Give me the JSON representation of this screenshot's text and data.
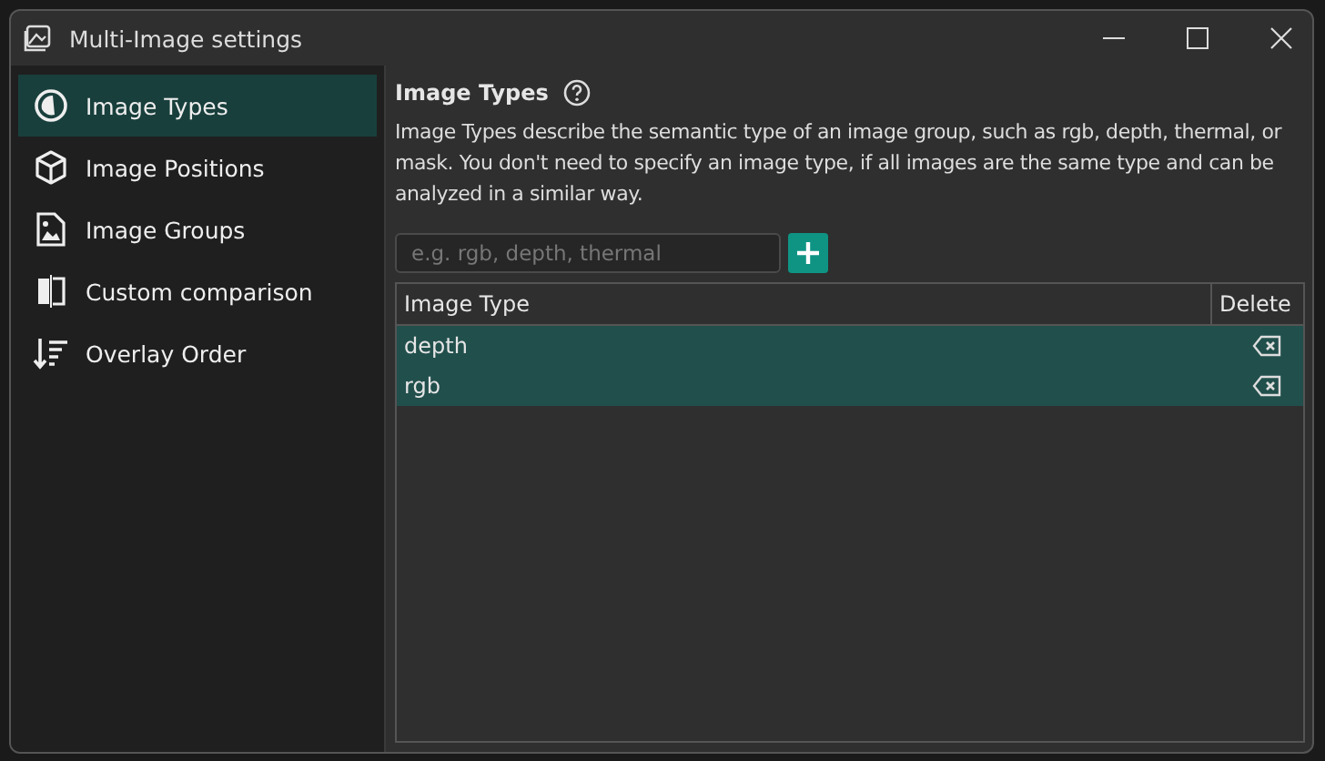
{
  "window": {
    "title": "Multi-Image settings"
  },
  "sidebar": {
    "items": [
      {
        "label": "Image Types",
        "selected": true
      },
      {
        "label": "Image Positions",
        "selected": false
      },
      {
        "label": "Image Groups",
        "selected": false
      },
      {
        "label": "Custom comparison",
        "selected": false
      },
      {
        "label": "Overlay Order",
        "selected": false
      }
    ]
  },
  "section": {
    "title": "Image Types",
    "description": "Image Types describe the semantic type of an image group, such as rgb, depth, thermal, or mask. You don't need to specify an image type, if all images are the same type and can be analyzed in a similar way."
  },
  "input": {
    "placeholder": "e.g. rgb, depth, thermal"
  },
  "table": {
    "columns": [
      "Image Type",
      "Delete"
    ],
    "rows": [
      {
        "name": "depth",
        "selected": true
      },
      {
        "name": "rgb",
        "selected": true
      }
    ]
  }
}
